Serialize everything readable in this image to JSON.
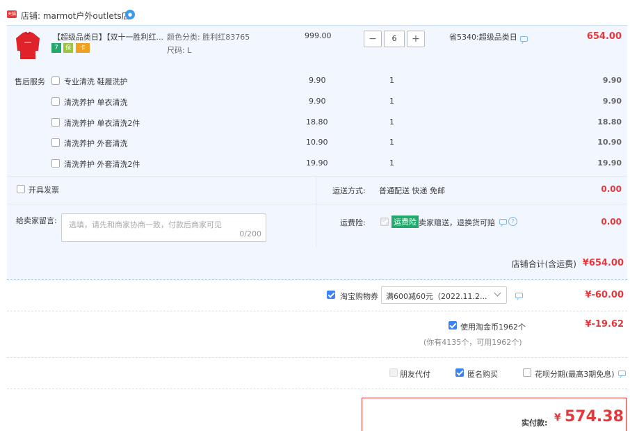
{
  "store": {
    "badge": "天猫",
    "label": "店铺: marmot户外outlets店"
  },
  "product": {
    "title": "【超级品类日】【双十一胜利红...",
    "color_label": "颜色分类: 胜利红83765",
    "size_label": "尺码: L",
    "unit_price": "999.00",
    "quantity": "6",
    "minus_label": "−",
    "plus_label": "+",
    "saving": "省5340:超级品类日",
    "subtotal": "654.00",
    "badges": [
      "7",
      "保",
      "卡"
    ]
  },
  "after_sales": {
    "label": "售后服务",
    "items": [
      {
        "name": "专业清洗 鞋履洗护",
        "price": "9.90",
        "qty": "1",
        "total": "9.90"
      },
      {
        "name": "清洗养护 单衣清洗",
        "price": "9.90",
        "qty": "1",
        "total": "9.90"
      },
      {
        "name": "清洗养护 单衣清洗2件",
        "price": "18.80",
        "qty": "1",
        "total": "18.80"
      },
      {
        "name": "清洗养护 外套清洗",
        "price": "10.90",
        "qty": "1",
        "total": "10.90"
      },
      {
        "name": "清洗养护 外套清洗2件",
        "price": "19.90",
        "qty": "1",
        "total": "19.90"
      }
    ]
  },
  "invoice": {
    "label": "开具发票"
  },
  "shipping": {
    "label": "运送方式:",
    "value": "普通配送 快递 免邮",
    "amount": "0.00"
  },
  "message": {
    "label": "给卖家留言:",
    "placeholder": "选填，请先和商家协商一致，付款后商家可见",
    "counter": "0/200"
  },
  "insurance": {
    "label": "运费险:",
    "badge": "运费险",
    "text": "卖家赠送，退换货可赔",
    "amount": "0.00"
  },
  "store_total": {
    "label": "店铺合计(含运费)",
    "amount": "¥654.00"
  },
  "coupon": {
    "label": "淘宝购物券",
    "select_value": "满600减60元（2022.11.2...",
    "amount": "¥-60.00"
  },
  "coins": {
    "label": "使用淘金币1962个",
    "note": "(你有4135个，可用1962个)",
    "amount": "¥-19.62"
  },
  "options": {
    "friend_pay": "朋友代付",
    "anonymous": "匿名购买",
    "huabei": "花呗分期(最高3期免息)"
  },
  "payment": {
    "label": "实付款:",
    "currency": "¥",
    "amount": "574.38"
  },
  "colors": {
    "price_red": "#e4393c",
    "row_bg": "#f2f7ff",
    "accent_blue": "#3b82f6"
  }
}
